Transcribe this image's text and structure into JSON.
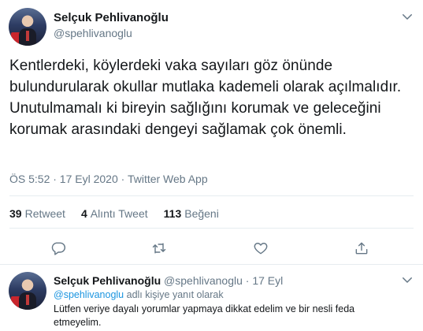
{
  "tweet": {
    "author_name": "Selçuk Pehlivanoğlu",
    "author_handle": "@spehlivanoglu",
    "text": "Kentlerdeki, köylerdeki vaka sayıları göz önünde bulundurularak okullar mutlaka kademeli olarak açılmalıdır. Unutulmamalı ki bireyin sağlığını korumak ve geleceğini korumak arasındaki dengeyi sağlamak çok önemli.",
    "meta": "ÖS 5:52 · 17 Eyl 2020 · Twitter Web App",
    "stats": {
      "retweets_count": "39",
      "retweets_label": "Retweet",
      "quotes_count": "4",
      "quotes_label": "Alıntı Tweet",
      "likes_count": "113",
      "likes_label": "Beğeni"
    },
    "actions": [
      "reply-icon",
      "retweet-icon",
      "like-icon",
      "share-icon"
    ]
  },
  "reply": {
    "author_name": "Selçuk Pehlivanoğlu",
    "author_handle": "@spehlivanoglu",
    "separator": "·",
    "date": "17 Eyl",
    "reply_to_mention": "@spehlivanoglu",
    "reply_to_suffix": "adlı kişiye yanıt olarak",
    "text": "Lütfen veriye dayalı yorumlar yapmaya dikkat edelim ve bir nesli feda etmeyelim."
  },
  "colors": {
    "text": "#14171a",
    "secondary": "#657786",
    "link": "#1b95e0",
    "divider": "#e6ecf0"
  }
}
